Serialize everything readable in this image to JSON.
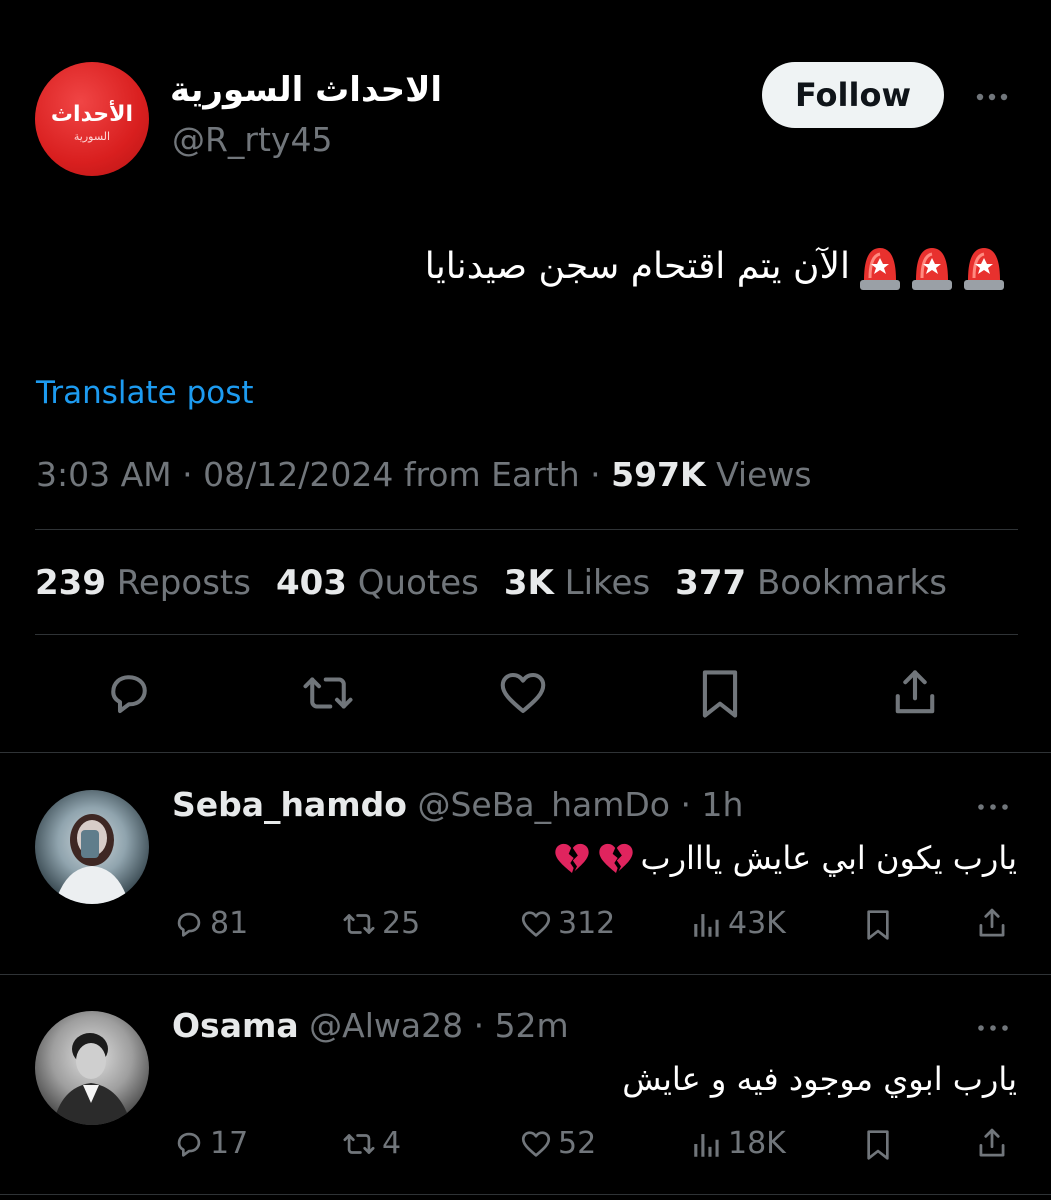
{
  "post": {
    "author": {
      "display_name": "الاحداث السورية",
      "handle": "@R_rty45",
      "avatar_logo_top": "الأحداث",
      "avatar_logo_bottom": "السورية"
    },
    "follow_label": "Follow",
    "text": "الآن يتم اقتحام سجن صيدنايا",
    "siren_emoji_count": 3,
    "translate_label": "Translate post",
    "meta": {
      "time": "3:03 AM",
      "date": "08/12/2024",
      "source": "from Earth",
      "views_count": "597K",
      "views_label": "Views"
    },
    "stats": [
      {
        "count": "239",
        "label": "Repost"
      },
      {
        "count": "403",
        "label": "Quotes"
      },
      {
        "count": "3K",
        "label": "Likes"
      },
      {
        "count": "377",
        "label": "Bookmarks"
      }
    ],
    "stats_reposts_label": "Reposts"
  },
  "replies": [
    {
      "name": "Seba_hamdo",
      "handle": "@SeBa_hamDo",
      "time": "1h",
      "text": "يارب يكون ابي عايش يااارب",
      "emoji": "broken-heart",
      "replies": "81",
      "reposts": "25",
      "likes": "312",
      "views": "43K"
    },
    {
      "name": "Osama",
      "handle": "@Alwa28",
      "time": "52m",
      "text": "يارب ابوي موجود فيه و عايش",
      "emoji": "",
      "replies": "17",
      "reposts": "4",
      "likes": "52",
      "views": "18K"
    }
  ],
  "colors": {
    "background": "#000000",
    "text": "#e7e9ea",
    "muted": "#71767b",
    "link": "#1d9bf0",
    "divider": "#2f3336",
    "avatar_red": "#d91f1f"
  }
}
